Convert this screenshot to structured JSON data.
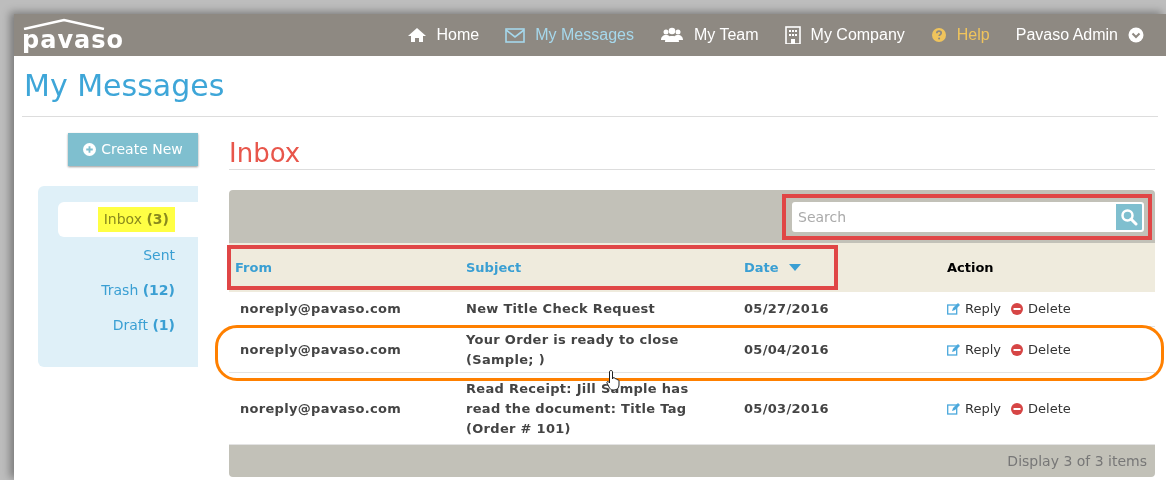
{
  "logo": "pavaso",
  "nav": [
    {
      "label": "Home",
      "kind": "home",
      "selected": false
    },
    {
      "label": "My Messages",
      "kind": "messages",
      "selected": true
    },
    {
      "label": "My Team",
      "kind": "team",
      "selected": false
    },
    {
      "label": "My Company",
      "kind": "company",
      "selected": false
    },
    {
      "label": "Help",
      "kind": "help",
      "selected": false
    },
    {
      "label": "Pavaso Admin",
      "kind": "user-menu",
      "selected": false
    }
  ],
  "page_title": "My Messages",
  "create_button": "Create New",
  "folders": [
    {
      "label": "Inbox",
      "count": "(3)",
      "selected": true
    },
    {
      "label": "Sent",
      "selected": false
    },
    {
      "label": "Trash",
      "count": "(12)",
      "selected": false
    },
    {
      "label": "Draft",
      "count": "(1)",
      "selected": false
    }
  ],
  "section_title": "Inbox",
  "search": {
    "placeholder": "Search"
  },
  "table": {
    "columns": [
      {
        "label": "From",
        "sortable": true,
        "sorted": false
      },
      {
        "label": "Subject",
        "sortable": true,
        "sorted": false
      },
      {
        "label": "Date",
        "sortable": true,
        "sorted": true
      },
      {
        "label": "Action",
        "sortable": false,
        "sorted": false
      }
    ],
    "rows": [
      {
        "from": "noreply@pavaso.com",
        "subject": "New Title Check Request",
        "date": "05/27/2016",
        "actions": [
          {
            "label": "Reply",
            "kind": "reply"
          },
          {
            "label": "Delete",
            "kind": "delete"
          }
        ]
      },
      {
        "from": "noreply@pavaso.com",
        "subject": "Your Order is ready to close (Sample; )",
        "date": "05/04/2016",
        "actions": [
          {
            "label": "Reply",
            "kind": "reply"
          },
          {
            "label": "Delete",
            "kind": "delete"
          }
        ]
      },
      {
        "from": "noreply@pavaso.com",
        "subject": "Read Receipt: Jill Sample has read the document: Title Tag (Order # 101)",
        "date": "05/03/2016",
        "actions": [
          {
            "label": "Reply",
            "kind": "reply"
          },
          {
            "label": "Delete",
            "kind": "delete"
          }
        ]
      }
    ],
    "footer": "Display 3 of 3 items"
  }
}
